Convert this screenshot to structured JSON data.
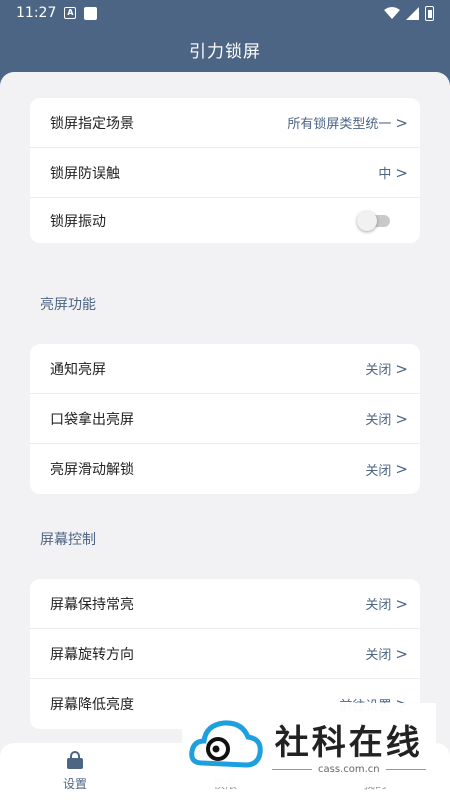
{
  "status_bar": {
    "time": "11:27",
    "a_badge": "A"
  },
  "title": "引力锁屏",
  "group1": [
    {
      "label": "锁屏指定场景",
      "value": "所有锁屏类型统一",
      "arrow": ">"
    },
    {
      "label": "锁屏防误触",
      "value": "中",
      "arrow": ">"
    },
    {
      "label": "锁屏振动",
      "toggle": false
    }
  ],
  "section2_title": "亮屏功能",
  "group2": [
    {
      "label": "通知亮屏",
      "value": "关闭",
      "arrow": ">"
    },
    {
      "label": "口袋拿出亮屏",
      "value": "关闭",
      "arrow": ">"
    },
    {
      "label": "亮屏滑动解锁",
      "value": "关闭",
      "arrow": ">"
    }
  ],
  "section3_title": "屏幕控制",
  "group3": [
    {
      "label": "屏幕保持常亮",
      "value": "关闭",
      "arrow": ">"
    },
    {
      "label": "屏幕旋转方向",
      "value": "关闭",
      "arrow": ">"
    },
    {
      "label": "屏幕降低亮度",
      "value": "前往设置",
      "arrow": ">"
    }
  ],
  "bottom_nav": [
    {
      "label": "设置",
      "icon": "lock-icon",
      "active": true
    },
    {
      "label": "权限",
      "icon": "shield-icon",
      "active": false
    },
    {
      "label": "我的",
      "icon": "user-icon",
      "active": false
    }
  ],
  "watermark": {
    "title": "社科在线",
    "domain": "cass.com.cn"
  },
  "colors": {
    "header": "#4d6585",
    "background": "#f2f2f4",
    "accent": "#4d6585",
    "toggle_off": "#c9c9c9"
  }
}
